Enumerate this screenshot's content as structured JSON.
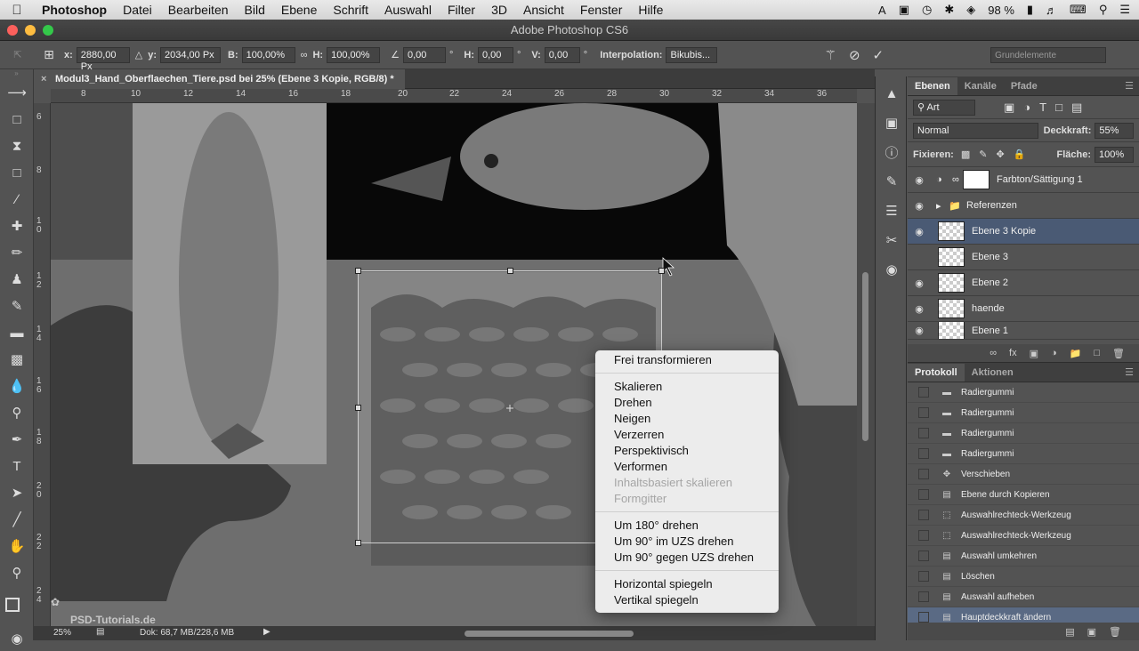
{
  "menubar": {
    "app": "Photoshop",
    "items": [
      "Datei",
      "Bearbeiten",
      "Bild",
      "Ebene",
      "Schrift",
      "Auswahl",
      "Filter",
      "3D",
      "Ansicht",
      "Fenster",
      "Hilfe"
    ],
    "battery": "98 %"
  },
  "window": {
    "title": "Adobe Photoshop CS6"
  },
  "options": {
    "x_label": "x:",
    "x_value": "2880,00 Px",
    "y_label": "y:",
    "y_value": "2034,00 Px",
    "b_label": "B:",
    "b_value": "100,00%",
    "h_label": "H:",
    "h_value": "100,00%",
    "angle_value": "0,00",
    "deg": "°",
    "hs_label": "H:",
    "hs_value": "0,00",
    "vs_label": "V:",
    "vs_value": "0,00",
    "interp_label": "Interpolation:",
    "interp_value": "Bikubis...",
    "workspace": "Grundelemente"
  },
  "document": {
    "tab": "Modul3_Hand_Oberflaechen_Tiere.psd bei 25% (Ebene 3 Kopie, RGB/8) *",
    "ruler_h": [
      "8",
      "10",
      "12",
      "14",
      "16",
      "18",
      "20",
      "22",
      "24",
      "26",
      "28",
      "30",
      "32",
      "34",
      "36"
    ],
    "ruler_v": [
      "6",
      "8",
      "1 0",
      "1 2",
      "1 4",
      "1 6",
      "1 8",
      "2 0",
      "2 2",
      "2 4",
      "2 6"
    ]
  },
  "status": {
    "zoom": "25%",
    "doc": "Dok: 68,7 MB/228,6 MB"
  },
  "watermark": "PSD-Tutorials.de",
  "layers_panel": {
    "tabs": [
      "Ebenen",
      "Kanäle",
      "Pfade"
    ],
    "filter": "Art",
    "blend": "Normal",
    "opacity_label": "Deckkraft:",
    "opacity": "55%",
    "lock_label": "Fixieren:",
    "fill_label": "Fläche:",
    "fill": "100%",
    "layers": [
      {
        "name": "Farbton/Sättigung 1"
      },
      {
        "name": "Referenzen"
      },
      {
        "name": "Ebene 3 Kopie"
      },
      {
        "name": "Ebene 3"
      },
      {
        "name": "Ebene 2"
      },
      {
        "name": "haende"
      },
      {
        "name": "Ebene 1"
      }
    ]
  },
  "history_panel": {
    "tabs": [
      "Protokoll",
      "Aktionen"
    ],
    "items": [
      "Radiergummi",
      "Radiergummi",
      "Radiergummi",
      "Radiergummi",
      "Verschieben",
      "Ebene durch Kopieren",
      "Auswahlrechteck-Werkzeug",
      "Auswahlrechteck-Werkzeug",
      "Auswahl umkehren",
      "Löschen",
      "Auswahl aufheben",
      "Hauptdeckkraft ändern"
    ]
  },
  "context_menu": {
    "items": [
      {
        "label": "Frei transformieren"
      },
      {
        "label": "Skalieren"
      },
      {
        "label": "Drehen"
      },
      {
        "label": "Neigen"
      },
      {
        "label": "Verzerren"
      },
      {
        "label": "Perspektivisch"
      },
      {
        "label": "Verformen"
      },
      {
        "label": "Inhaltsbasiert skalieren"
      },
      {
        "label": "Formgitter"
      },
      {
        "label": "Um 180° drehen"
      },
      {
        "label": "Um 90° im UZS drehen"
      },
      {
        "label": "Um 90° gegen UZS drehen"
      },
      {
        "label": "Horizontal spiegeln"
      },
      {
        "label": "Vertikal spiegeln"
      }
    ]
  }
}
